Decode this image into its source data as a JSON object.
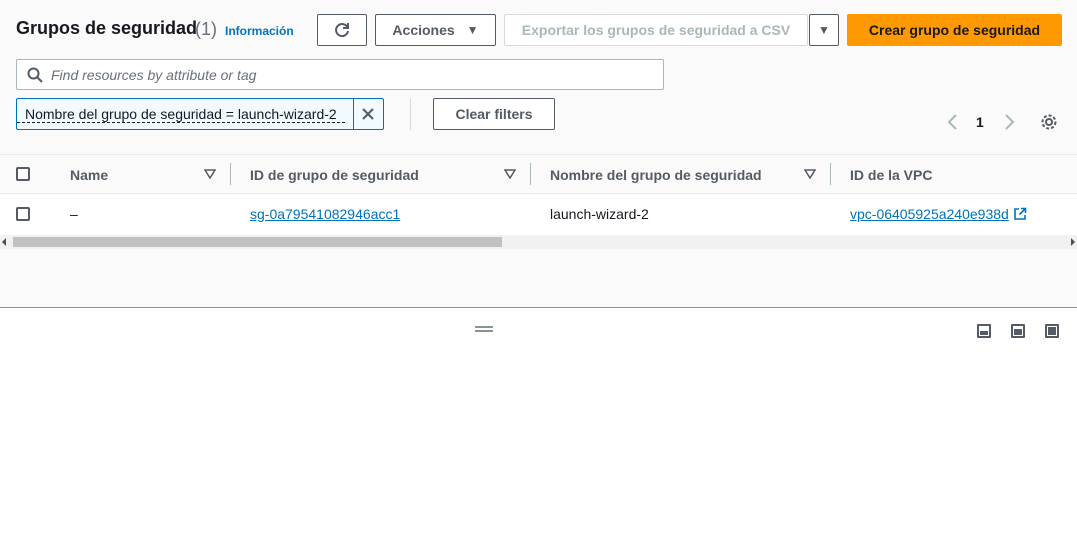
{
  "header": {
    "title": "Grupos de seguridad",
    "count": "(1)",
    "info_link": "Información"
  },
  "toolbar": {
    "refresh_icon": "refresh-icon",
    "actions_label": "Acciones",
    "export_label": "Exportar los grupos de seguridad a CSV",
    "create_label": "Crear grupo de seguridad"
  },
  "search": {
    "placeholder": "Find resources by attribute or tag",
    "value": ""
  },
  "filters": {
    "token_label": "Nombre del grupo de seguridad = launch-wizard-2",
    "clear_label": "Clear filters"
  },
  "pagination": {
    "current_page": "1"
  },
  "table": {
    "columns": [
      "Name",
      "ID de grupo de seguridad",
      "Nombre del grupo de seguridad",
      "ID de la VPC"
    ],
    "rows": [
      {
        "name": "–",
        "sg_id": "sg-0a79541082946acc1",
        "sg_name": "launch-wizard-2",
        "vpc_id": "vpc-06405925a240e938d"
      }
    ]
  },
  "colors": {
    "primary": "#ff9900",
    "link": "#0073bb",
    "text": "#16191f",
    "muted": "#545b64"
  }
}
